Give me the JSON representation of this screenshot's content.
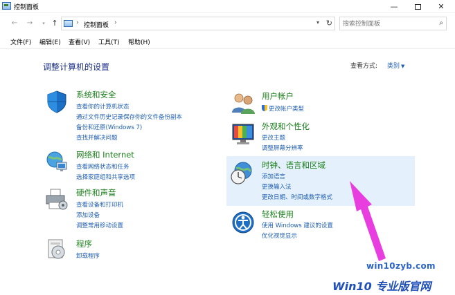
{
  "window": {
    "title": "控制面板"
  },
  "address": {
    "crumb": "控制面板",
    "sep": "›"
  },
  "search": {
    "placeholder": "搜索控制面板"
  },
  "menu": [
    "文件(F)",
    "编辑(E)",
    "查看(V)",
    "工具(T)",
    "帮助(H)"
  ],
  "main": {
    "heading": "调整计算机的设置",
    "view_by_label": "查看方式:",
    "view_by_value": "类别"
  },
  "categories": {
    "security": {
      "title": "系统和安全",
      "links": [
        "查看你的计算机状态",
        "通过文件历史记录保存你的文件备份副本",
        "备份和还原(Windows 7)",
        "查找并解决问题"
      ]
    },
    "network": {
      "title": "网络和 Internet",
      "links": [
        "查看网络状态和任务",
        "选择家庭组和共享选项"
      ]
    },
    "hardware": {
      "title": "硬件和声音",
      "links": [
        "查看设备和打印机",
        "添加设备",
        "调整常用移动设置"
      ]
    },
    "programs": {
      "title": "程序",
      "links": [
        "卸载程序"
      ]
    },
    "accounts": {
      "title": "用户帐户",
      "links": [
        "更改帐户类型"
      ]
    },
    "appearance": {
      "title": "外观和个性化",
      "links": [
        "更改主题",
        "调整屏幕分辨率"
      ]
    },
    "clock": {
      "title": "时钟、语言和区域",
      "links": [
        "添加语言",
        "更换输入法",
        "更改日期、时间或数字格式"
      ]
    },
    "ease": {
      "title": "轻松使用",
      "links": [
        "使用 Windows 建议的设置",
        "优化视觉显示"
      ]
    }
  },
  "watermark": {
    "site": "win10zyb.com",
    "brand": "Win10 专业版官网"
  },
  "colors": {
    "link": "#1f5fb3",
    "category_title": "#1a7f1a",
    "heading": "#1e3287",
    "highlight": "#e4f0fb",
    "arrow": "#e83ee0"
  }
}
